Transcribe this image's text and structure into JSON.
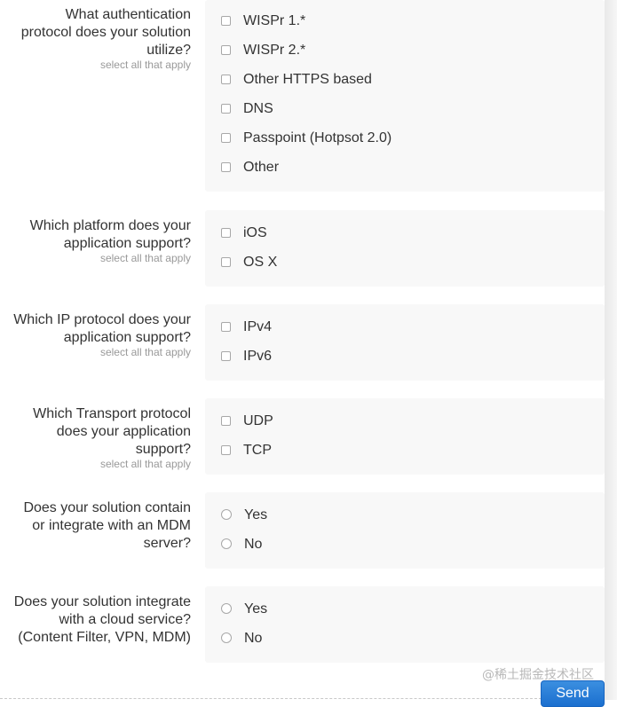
{
  "questions": [
    {
      "text": "What authentication\nprotocol does your solution\nutilize?",
      "hint": "select all that apply",
      "options": [
        "WISPr 1.*",
        "WISPr 2.*",
        "Other HTTPS based",
        "DNS",
        "Passpoint (Hotpsot 2.0)",
        "Other"
      ]
    },
    {
      "text": "Which platform does your\napplication support?",
      "hint": "select all that apply",
      "options": [
        "iOS",
        "OS X"
      ]
    },
    {
      "text": "Which IP protocol does your\napplication support?",
      "hint": "select all that apply",
      "options": [
        "IPv4",
        "IPv6"
      ]
    },
    {
      "text": "Which Transport protocol\ndoes your application\nsupport?",
      "hint": "select all that apply",
      "options": [
        "UDP",
        "TCP"
      ]
    },
    {
      "text": "Does your solution contain\nor integrate with an MDM\nserver?",
      "options": [
        "Yes",
        "No"
      ]
    },
    {
      "text": "Does your solution integrate\nwith a cloud service?\n(Content Filter, VPN, MDM)",
      "options": [
        "Yes",
        "No"
      ]
    }
  ],
  "send_label": "Send",
  "watermark": "@稀土掘金技术社区"
}
